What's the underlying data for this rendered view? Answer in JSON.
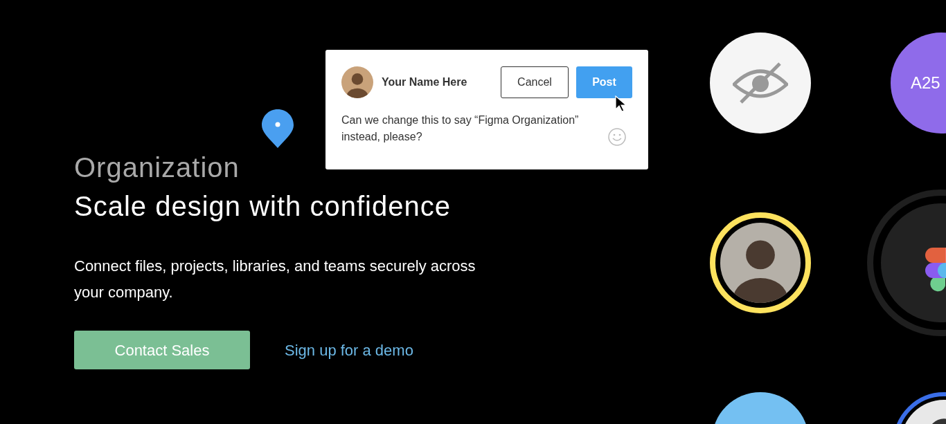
{
  "hero": {
    "eyebrow": "Organization",
    "title": "Scale design with confidence",
    "description": "Connect files, projects, libraries, and teams securely across your company.",
    "primary_button": "Contact Sales",
    "link": "Sign up for a demo"
  },
  "comment": {
    "author": "Your Name Here",
    "cancel": "Cancel",
    "post": "Post",
    "text": "Can we change this to say “Figma Organization” instead, please?"
  },
  "tag_badge": {
    "label": "A25"
  }
}
